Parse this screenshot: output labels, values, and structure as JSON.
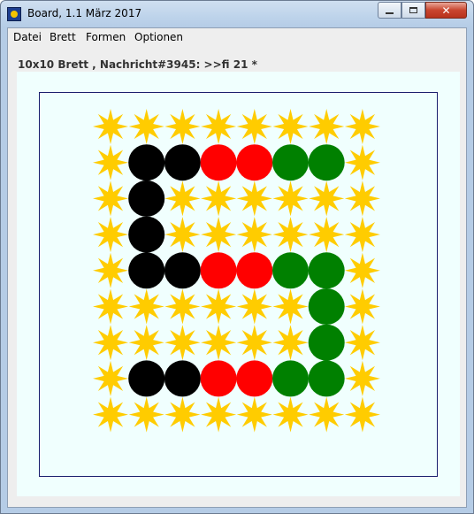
{
  "window": {
    "title": "Board, 1.1 März 2017",
    "icon": "app-board-icon",
    "controls": {
      "minimize_icon": "minimize-icon",
      "maximize_icon": "maximize-icon",
      "close_icon": "close-icon"
    }
  },
  "menubar": {
    "items": [
      {
        "label": "Datei"
      },
      {
        "label": "Brett"
      },
      {
        "label": "Formen"
      },
      {
        "label": "Optionen"
      }
    ]
  },
  "status": {
    "text": "10x10 Brett , Nachricht#3945: >>fi 21 *"
  },
  "board": {
    "rows": 10,
    "cols": 10,
    "visible_rows": 9,
    "visible_cols": 8,
    "colors": {
      "background": "#f0fffe",
      "star": "#ffcc00",
      "black": "#000000",
      "red": "#ff0000",
      "green": "#008000"
    },
    "cells": [
      [
        "star",
        "star",
        "star",
        "star",
        "star",
        "star",
        "star",
        "star"
      ],
      [
        "star",
        "black",
        "black",
        "red",
        "red",
        "green",
        "green",
        "star"
      ],
      [
        "star",
        "black",
        "star",
        "star",
        "star",
        "star",
        "star",
        "star"
      ],
      [
        "star",
        "black",
        "star",
        "star",
        "star",
        "star",
        "star",
        "star"
      ],
      [
        "star",
        "black",
        "black",
        "red",
        "red",
        "green",
        "green",
        "star"
      ],
      [
        "star",
        "star",
        "star",
        "star",
        "star",
        "star",
        "green",
        "star"
      ],
      [
        "star",
        "star",
        "star",
        "star",
        "star",
        "star",
        "green",
        "star"
      ],
      [
        "star",
        "black",
        "black",
        "red",
        "red",
        "green",
        "green",
        "star"
      ],
      [
        "star",
        "star",
        "star",
        "star",
        "star",
        "star",
        "star",
        "star"
      ]
    ]
  }
}
